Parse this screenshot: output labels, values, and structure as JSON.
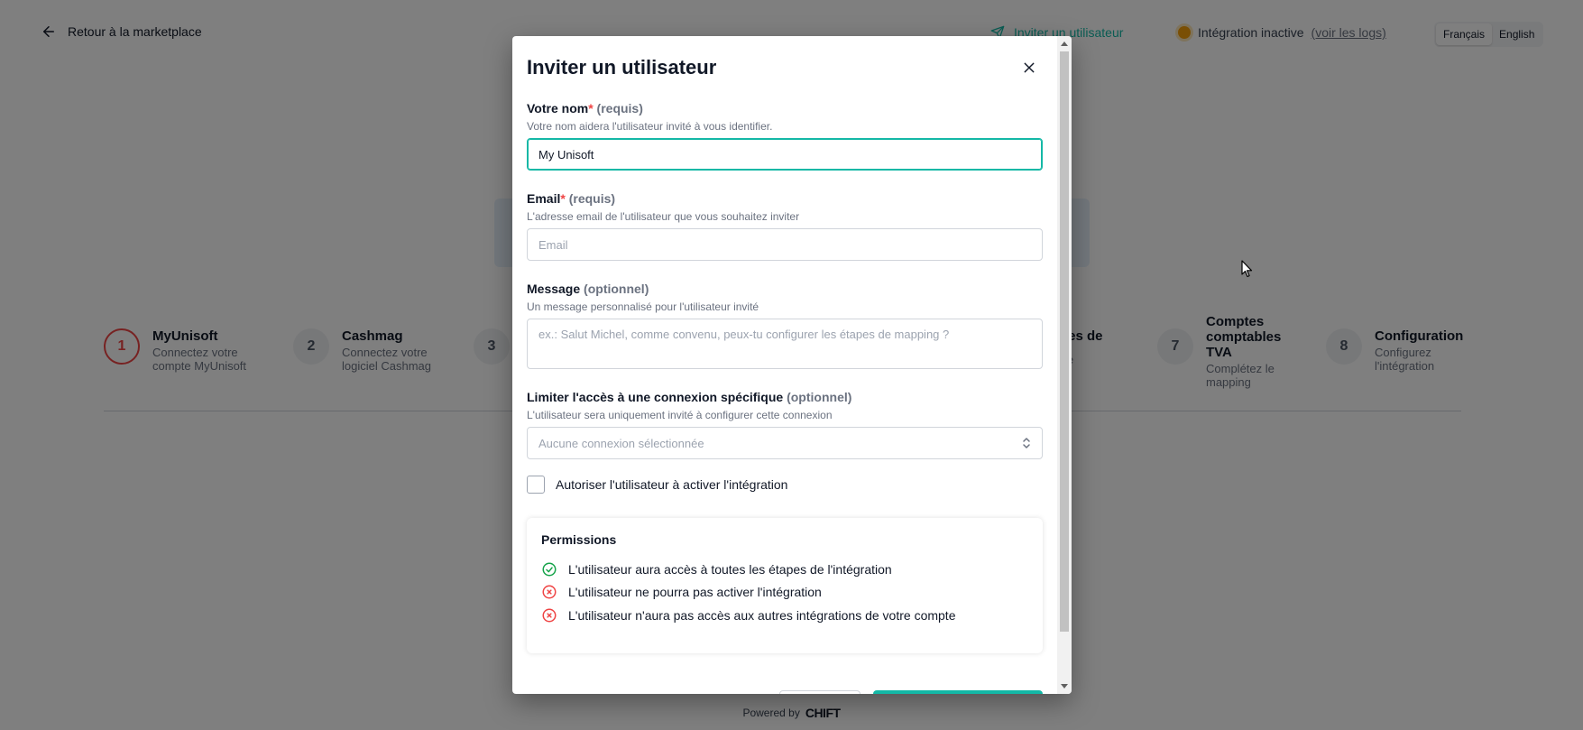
{
  "topbar": {
    "back_label": "Retour à la marketplace",
    "invite_label": "Inviter un utilisateur",
    "status_label": "Intégration inactive",
    "status_link": "(voir les logs)",
    "languages": [
      "Français",
      "English"
    ],
    "active_language": "Français"
  },
  "steps": [
    {
      "num": "1",
      "title": "MyUnisoft",
      "desc": "Connectez votre compte MyUnisoft"
    },
    {
      "num": "2",
      "title": "Cashmag",
      "desc": "Connectez votre logiciel Cashmag"
    },
    {
      "num": "3",
      "title": "",
      "desc": ""
    },
    {
      "num": "",
      "title": "les de",
      "desc": "le"
    },
    {
      "num": "7",
      "title": "Comptes comptables TVA",
      "desc": "Complétez le mapping"
    },
    {
      "num": "8",
      "title": "Configuration",
      "desc": "Configurez l'intégration"
    }
  ],
  "footer": {
    "powered_by": "Powered by",
    "logo": "CHIFT"
  },
  "modal": {
    "title": "Inviter un utilisateur",
    "name_field": {
      "label": "Votre nom",
      "required_star": "*",
      "note": "(requis)",
      "help": "Votre nom aidera l'utilisateur invité à vous identifier.",
      "value": "My Unisoft"
    },
    "email_field": {
      "label": "Email",
      "required_star": "*",
      "note": "(requis)",
      "help": "L'adresse email de l'utilisateur que vous souhaitez inviter",
      "placeholder": "Email"
    },
    "message_field": {
      "label": "Message",
      "note": "(optionnel)",
      "help": "Un message personnalisé pour l'utilisateur invité",
      "placeholder": "ex.: Salut Michel, comme convenu, peux-tu configurer les étapes de mapping ?"
    },
    "connection_field": {
      "label": "Limiter l'accès à une connexion spécifique",
      "note": "(optionnel)",
      "help": "L'utilisateur sera uniquement invité à configurer cette connexion",
      "selected": "Aucune connexion sélectionnée"
    },
    "activate_checkbox": {
      "label": "Autoriser l'utilisateur à activer l'intégration",
      "checked": false
    },
    "permissions": {
      "title": "Permissions",
      "items": [
        {
          "text": "L'utilisateur aura accès à toutes les étapes de l'intégration",
          "status": "allowed"
        },
        {
          "text": "L'utilisateur ne pourra pas activer l'intégration",
          "status": "denied"
        },
        {
          "text": "L'utilisateur n'aura pas accès aux autres intégrations de votre compte",
          "status": "denied"
        }
      ]
    }
  },
  "colors": {
    "accent": "#14b8a6",
    "error": "#ef4444",
    "success": "#16a34a",
    "warning": "#f59e0b"
  }
}
